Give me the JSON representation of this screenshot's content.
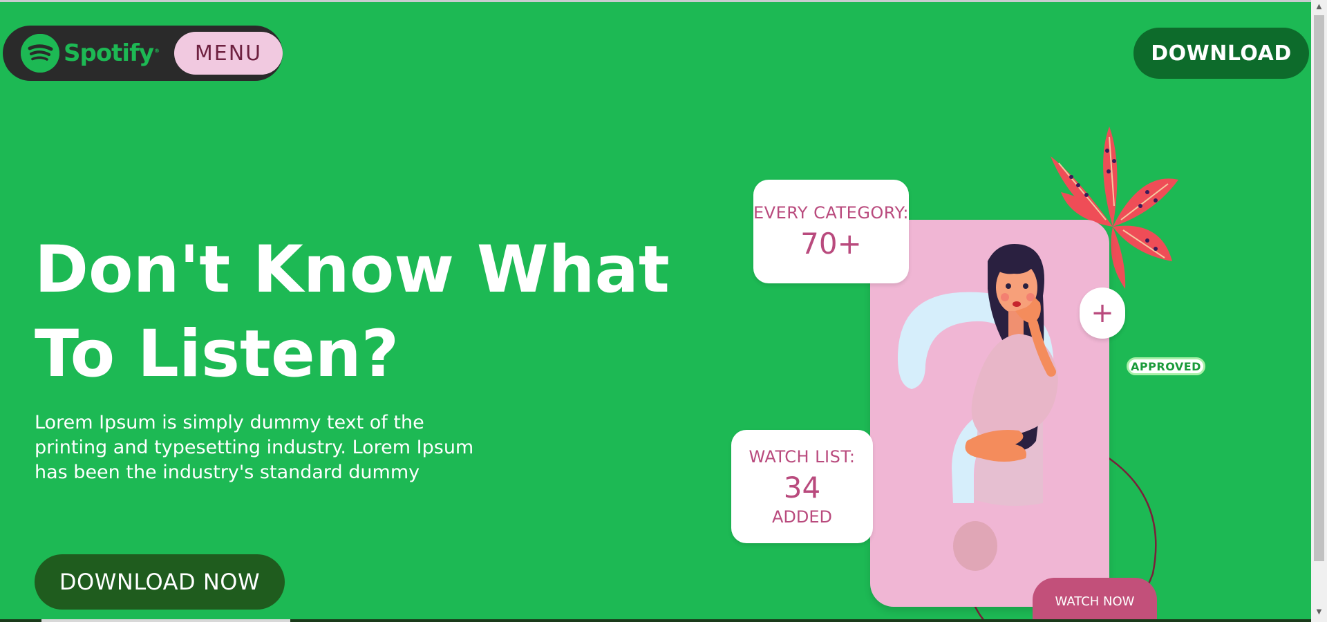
{
  "colors": {
    "brand_green": "#1db954",
    "dark_pill": "#2a2a2a",
    "menu_pink": "#f1c9e0",
    "download_dark_green": "#0d6b2b",
    "download_now_green": "#1f5c1e",
    "phone_pink": "#f0b6d4",
    "card_text": "#b94a7d",
    "watch_now_bg": "#c2507a",
    "approved_text": "#1a9a3a",
    "flower_red": "#ef4d57"
  },
  "nav": {
    "logo_text": "Spotify",
    "logo_mark": "®",
    "logo_icon": "spotify-logo-icon",
    "menu_label": "MENU",
    "download_label": "DOWNLOAD"
  },
  "hero": {
    "title_line1": "Don't Know What",
    "title_line2": "To Listen?",
    "description_line1": "Lorem Ipsum is simply dummy text of the",
    "description_line2": "printing and typesetting industry. Lorem Ipsum",
    "description_line3": "has been the industry's standard dummy",
    "cta_label": "DOWNLOAD NOW"
  },
  "illustration": {
    "category_card": {
      "label": "EVERY CATEGORY:",
      "value": "70+"
    },
    "watchlist_card": {
      "label": "WATCH LIST:",
      "value": "34",
      "sub": "ADDED"
    },
    "plus_symbol": "+",
    "approved_label": "APPROVED",
    "watch_now_label": "WATCH NOW",
    "phone_art": "thinking-woman-question-mark-illustration",
    "flower": "red-flower-illustration"
  },
  "scrollbar": {
    "up_glyph": "▲",
    "down_glyph": "▼"
  }
}
